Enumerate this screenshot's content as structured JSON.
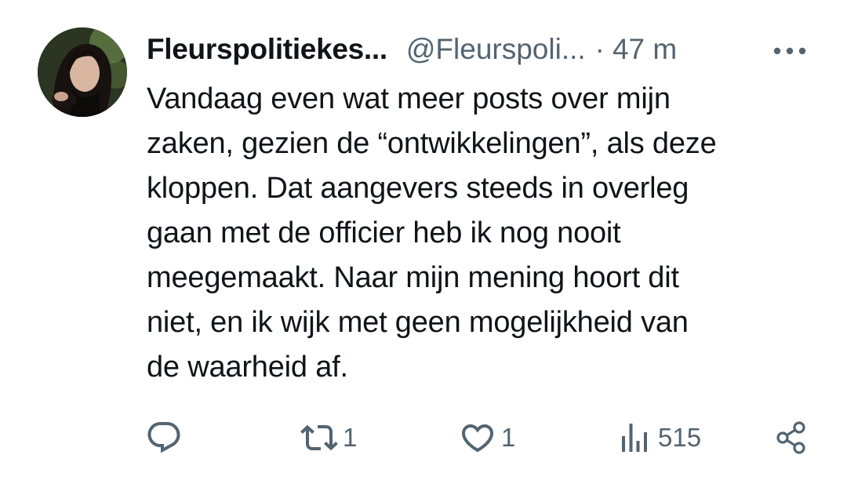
{
  "tweet": {
    "display_name": "Fleurspolitiekes...",
    "handle": "@Fleurspoli...",
    "separator": "·",
    "time": "47 m",
    "text_lines": [
      "Vandaag even wat meer posts over mijn",
      "zaken, gezien de “ontwikkelingen”, als deze",
      "kloppen. Dat aangevers steeds in overleg",
      "gaan met de officier heb ik nog nooit",
      "meegemaakt. Naar mijn mening hoort dit",
      "niet, en ik wijk met geen mogelijkheid van",
      "de waarheid af."
    ],
    "actions": {
      "reply": {
        "icon": "reply-icon",
        "count": ""
      },
      "retweet": {
        "icon": "retweet-icon",
        "count": "1"
      },
      "like": {
        "icon": "heart-icon",
        "count": "1"
      },
      "views": {
        "icon": "views-icon",
        "count": "515"
      },
      "share": {
        "icon": "share-icon",
        "count": ""
      }
    },
    "more_icon": "more-icon"
  },
  "colors": {
    "text": "#0f1419",
    "secondary": "#536471",
    "background": "#ffffff"
  }
}
